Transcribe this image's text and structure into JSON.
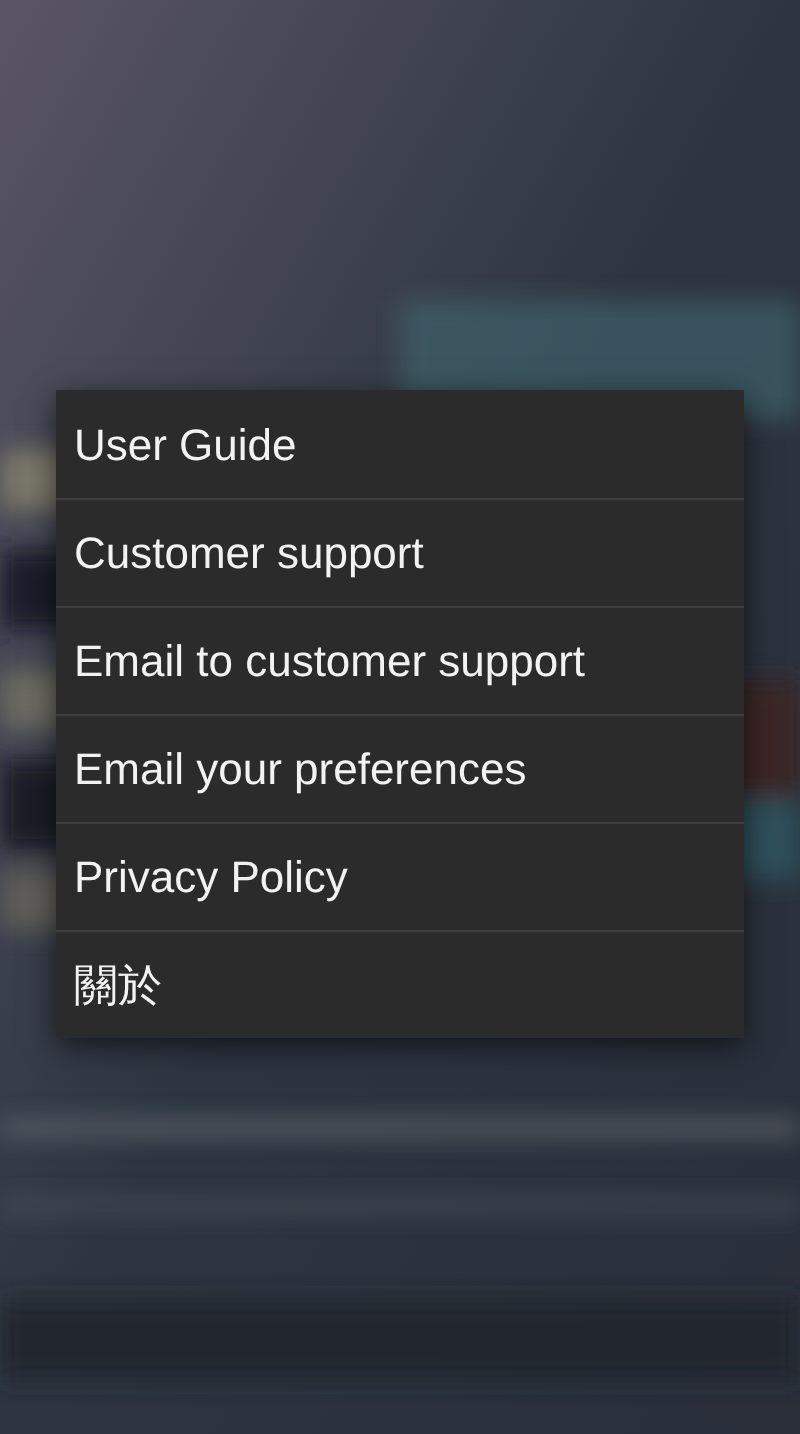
{
  "menu": {
    "items": [
      {
        "label": "User Guide"
      },
      {
        "label": "Customer support"
      },
      {
        "label": "Email to customer support"
      },
      {
        "label": "Email your preferences"
      },
      {
        "label": "Privacy Policy"
      },
      {
        "label": "關於"
      }
    ]
  }
}
